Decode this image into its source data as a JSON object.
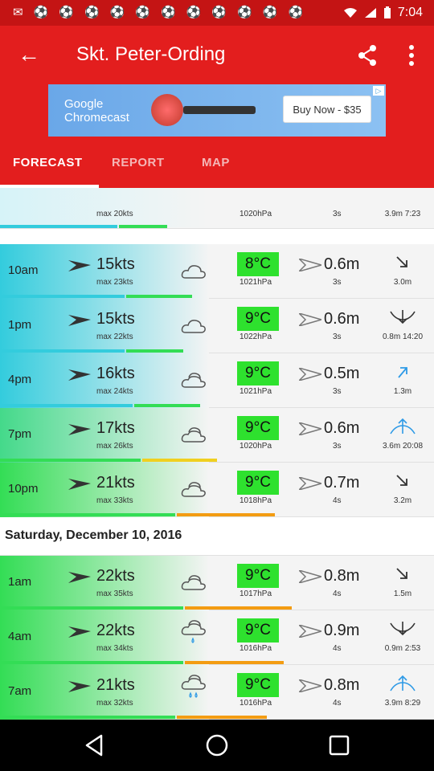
{
  "status": {
    "time": "7:04"
  },
  "header": {
    "title": "Skt. Peter-Ording"
  },
  "ad": {
    "brand": "Google Chromecast",
    "button": "Buy Now - $35"
  },
  "tabs": [
    {
      "label": "FORECAST",
      "active": true
    },
    {
      "label": "REPORT",
      "active": false
    },
    {
      "label": "MAP",
      "active": false
    }
  ],
  "partial_row": {
    "wind_max": "max 20kts",
    "pressure": "1020hPa",
    "period": "3s",
    "tide": "3.9m 7:23"
  },
  "rows_day1": [
    {
      "time": "10am",
      "wind": "15kts",
      "wind_max": "max 23kts",
      "temp": "8°C",
      "pressure": "1021hPa",
      "wave": "0.6m",
      "period": "3s",
      "tide": "3.0m",
      "tide_dir": "down",
      "weather": "cloud"
    },
    {
      "time": "1pm",
      "wind": "15kts",
      "wind_max": "max 22kts",
      "temp": "9°C",
      "pressure": "1022hPa",
      "wave": "0.6m",
      "period": "3s",
      "tide": "0.8m 14:20",
      "tide_dir": "low",
      "weather": "cloud"
    },
    {
      "time": "4pm",
      "wind": "16kts",
      "wind_max": "max 24kts",
      "temp": "9°C",
      "pressure": "1021hPa",
      "wave": "0.5m",
      "period": "3s",
      "tide": "1.3m",
      "tide_dir": "up",
      "weather": "clouds"
    },
    {
      "time": "7pm",
      "wind": "17kts",
      "wind_max": "max 26kts",
      "temp": "9°C",
      "pressure": "1020hPa",
      "wave": "0.6m",
      "period": "3s",
      "tide": "3.6m 20:08",
      "tide_dir": "high",
      "weather": "clouds"
    },
    {
      "time": "10pm",
      "wind": "21kts",
      "wind_max": "max 33kts",
      "temp": "9°C",
      "pressure": "1018hPa",
      "wave": "0.7m",
      "period": "4s",
      "tide": "3.2m",
      "tide_dir": "down",
      "weather": "clouds"
    }
  ],
  "date2": "Saturday, December 10, 2016",
  "rows_day2": [
    {
      "time": "1am",
      "wind": "22kts",
      "wind_max": "max 35kts",
      "temp": "9°C",
      "pressure": "1017hPa",
      "wave": "0.8m",
      "period": "4s",
      "tide": "1.5m",
      "tide_dir": "down",
      "weather": "clouds"
    },
    {
      "time": "4am",
      "wind": "22kts",
      "wind_max": "max 34kts",
      "temp": "9°C",
      "pressure": "1016hPa",
      "wave": "0.9m",
      "period": "4s",
      "tide": "0.9m 2:53",
      "tide_dir": "low",
      "weather": "rain-light"
    },
    {
      "time": "7am",
      "wind": "21kts",
      "wind_max": "max 32kts",
      "temp": "9°C",
      "pressure": "1016hPa",
      "wave": "0.8m",
      "period": "4s",
      "tide": "3.9m 8:29",
      "tide_dir": "high",
      "weather": "rain"
    }
  ],
  "colors": {
    "appbar": "#e31e1e",
    "statusbar": "#c41414",
    "temp_badge": "#2ee12e",
    "accent_cyan": "#33ccdd",
    "accent_green": "#33dd55",
    "tide_icon": "#2e9ae6"
  }
}
